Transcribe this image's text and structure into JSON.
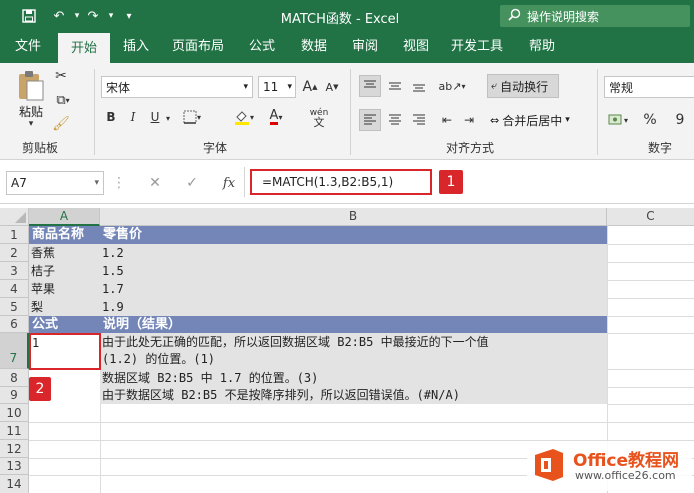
{
  "title_bar": {
    "title": "MATCH函数  -  Excel",
    "tell_me": "操作说明搜索"
  },
  "tabs": [
    "文件",
    "开始",
    "插入",
    "页面布局",
    "公式",
    "数据",
    "审阅",
    "视图",
    "开发工具",
    "帮助"
  ],
  "active_tab": "开始",
  "ribbon": {
    "clipboard": {
      "paste": "粘贴",
      "label": "剪贴板"
    },
    "font": {
      "name": "宋体",
      "size": "11",
      "label": "字体",
      "bold": "B",
      "italic": "I",
      "underline": "U",
      "grow": "A",
      "shrink": "A",
      "wen": "wén"
    },
    "alignment": {
      "wrap": "自动换行",
      "merge": "合并后居中",
      "label": "对齐方式"
    },
    "number": {
      "format": "常规",
      "percent": "%",
      "label": "数字"
    }
  },
  "formula_bar": {
    "name_box": "A7",
    "fx": "fx",
    "formula": "=MATCH(1.3,B2:B5,1)",
    "badge1": "1"
  },
  "columns": [
    "A",
    "B",
    "C"
  ],
  "rows": [
    "1",
    "2",
    "3",
    "4",
    "5",
    "6",
    "7",
    "8",
    "9",
    "10",
    "11",
    "12",
    "13",
    "14"
  ],
  "sheet": {
    "r1": {
      "a": "商品名称",
      "b": "零售价"
    },
    "r2": {
      "a": "香蕉",
      "b": "1.2"
    },
    "r3": {
      "a": "桔子",
      "b": "1.5"
    },
    "r4": {
      "a": "苹果",
      "b": "1.7"
    },
    "r5": {
      "a": "梨",
      "b": "1.9"
    },
    "r6": {
      "a": "公式",
      "b": "说明（结果）"
    },
    "r7": {
      "a": "1",
      "b1": "由于此处无正确的匹配，所以返回数据区域 B2:B5 中最接近的下一个值",
      "b2": "(1.2) 的位置。(1)"
    },
    "r8": {
      "b": "数据区域 B2:B5 中 1.7 的位置。(3)"
    },
    "r9": {
      "b": "由于数据区域 B2:B5 不是按降序排列，所以返回错误值。(#N/A)"
    }
  },
  "badge2": "2",
  "watermark": {
    "brand": "Office教程网",
    "url": "www.office26.com"
  },
  "colors": {
    "excel_green": "#217346",
    "header_band": "#7386b7",
    "gray_band": "#e3e3e3",
    "highlight": "#d9262a",
    "watermark_orange": "#e8531d"
  }
}
